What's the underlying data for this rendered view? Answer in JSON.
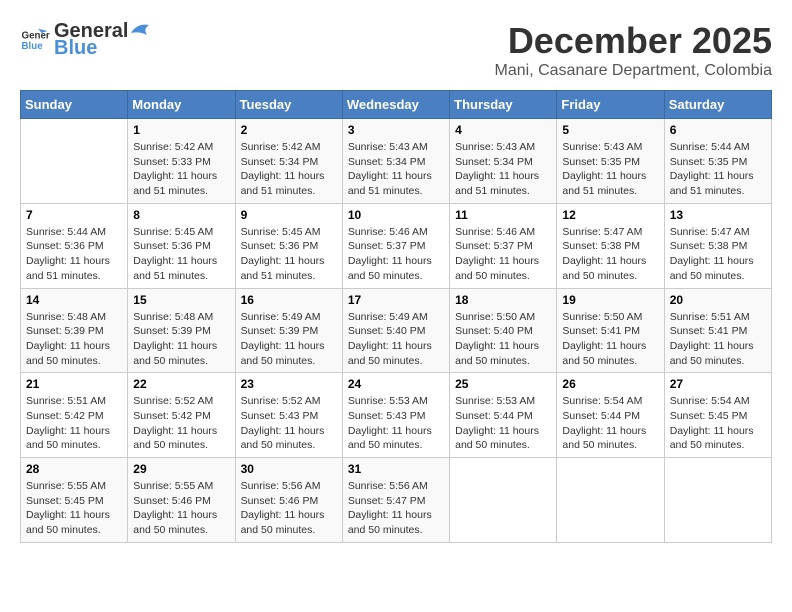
{
  "header": {
    "logo_general": "General",
    "logo_blue": "Blue",
    "title": "December 2025",
    "subtitle": "Mani, Casanare Department, Colombia"
  },
  "days_of_week": [
    "Sunday",
    "Monday",
    "Tuesday",
    "Wednesday",
    "Thursday",
    "Friday",
    "Saturday"
  ],
  "weeks": [
    [
      {
        "day": "",
        "sunrise": "",
        "sunset": "",
        "daylight": ""
      },
      {
        "day": "1",
        "sunrise": "Sunrise: 5:42 AM",
        "sunset": "Sunset: 5:33 PM",
        "daylight": "Daylight: 11 hours and 51 minutes."
      },
      {
        "day": "2",
        "sunrise": "Sunrise: 5:42 AM",
        "sunset": "Sunset: 5:34 PM",
        "daylight": "Daylight: 11 hours and 51 minutes."
      },
      {
        "day": "3",
        "sunrise": "Sunrise: 5:43 AM",
        "sunset": "Sunset: 5:34 PM",
        "daylight": "Daylight: 11 hours and 51 minutes."
      },
      {
        "day": "4",
        "sunrise": "Sunrise: 5:43 AM",
        "sunset": "Sunset: 5:34 PM",
        "daylight": "Daylight: 11 hours and 51 minutes."
      },
      {
        "day": "5",
        "sunrise": "Sunrise: 5:43 AM",
        "sunset": "Sunset: 5:35 PM",
        "daylight": "Daylight: 11 hours and 51 minutes."
      },
      {
        "day": "6",
        "sunrise": "Sunrise: 5:44 AM",
        "sunset": "Sunset: 5:35 PM",
        "daylight": "Daylight: 11 hours and 51 minutes."
      }
    ],
    [
      {
        "day": "7",
        "sunrise": "Sunrise: 5:44 AM",
        "sunset": "Sunset: 5:36 PM",
        "daylight": "Daylight: 11 hours and 51 minutes."
      },
      {
        "day": "8",
        "sunrise": "Sunrise: 5:45 AM",
        "sunset": "Sunset: 5:36 PM",
        "daylight": "Daylight: 11 hours and 51 minutes."
      },
      {
        "day": "9",
        "sunrise": "Sunrise: 5:45 AM",
        "sunset": "Sunset: 5:36 PM",
        "daylight": "Daylight: 11 hours and 51 minutes."
      },
      {
        "day": "10",
        "sunrise": "Sunrise: 5:46 AM",
        "sunset": "Sunset: 5:37 PM",
        "daylight": "Daylight: 11 hours and 50 minutes."
      },
      {
        "day": "11",
        "sunrise": "Sunrise: 5:46 AM",
        "sunset": "Sunset: 5:37 PM",
        "daylight": "Daylight: 11 hours and 50 minutes."
      },
      {
        "day": "12",
        "sunrise": "Sunrise: 5:47 AM",
        "sunset": "Sunset: 5:38 PM",
        "daylight": "Daylight: 11 hours and 50 minutes."
      },
      {
        "day": "13",
        "sunrise": "Sunrise: 5:47 AM",
        "sunset": "Sunset: 5:38 PM",
        "daylight": "Daylight: 11 hours and 50 minutes."
      }
    ],
    [
      {
        "day": "14",
        "sunrise": "Sunrise: 5:48 AM",
        "sunset": "Sunset: 5:39 PM",
        "daylight": "Daylight: 11 hours and 50 minutes."
      },
      {
        "day": "15",
        "sunrise": "Sunrise: 5:48 AM",
        "sunset": "Sunset: 5:39 PM",
        "daylight": "Daylight: 11 hours and 50 minutes."
      },
      {
        "day": "16",
        "sunrise": "Sunrise: 5:49 AM",
        "sunset": "Sunset: 5:39 PM",
        "daylight": "Daylight: 11 hours and 50 minutes."
      },
      {
        "day": "17",
        "sunrise": "Sunrise: 5:49 AM",
        "sunset": "Sunset: 5:40 PM",
        "daylight": "Daylight: 11 hours and 50 minutes."
      },
      {
        "day": "18",
        "sunrise": "Sunrise: 5:50 AM",
        "sunset": "Sunset: 5:40 PM",
        "daylight": "Daylight: 11 hours and 50 minutes."
      },
      {
        "day": "19",
        "sunrise": "Sunrise: 5:50 AM",
        "sunset": "Sunset: 5:41 PM",
        "daylight": "Daylight: 11 hours and 50 minutes."
      },
      {
        "day": "20",
        "sunrise": "Sunrise: 5:51 AM",
        "sunset": "Sunset: 5:41 PM",
        "daylight": "Daylight: 11 hours and 50 minutes."
      }
    ],
    [
      {
        "day": "21",
        "sunrise": "Sunrise: 5:51 AM",
        "sunset": "Sunset: 5:42 PM",
        "daylight": "Daylight: 11 hours and 50 minutes."
      },
      {
        "day": "22",
        "sunrise": "Sunrise: 5:52 AM",
        "sunset": "Sunset: 5:42 PM",
        "daylight": "Daylight: 11 hours and 50 minutes."
      },
      {
        "day": "23",
        "sunrise": "Sunrise: 5:52 AM",
        "sunset": "Sunset: 5:43 PM",
        "daylight": "Daylight: 11 hours and 50 minutes."
      },
      {
        "day": "24",
        "sunrise": "Sunrise: 5:53 AM",
        "sunset": "Sunset: 5:43 PM",
        "daylight": "Daylight: 11 hours and 50 minutes."
      },
      {
        "day": "25",
        "sunrise": "Sunrise: 5:53 AM",
        "sunset": "Sunset: 5:44 PM",
        "daylight": "Daylight: 11 hours and 50 minutes."
      },
      {
        "day": "26",
        "sunrise": "Sunrise: 5:54 AM",
        "sunset": "Sunset: 5:44 PM",
        "daylight": "Daylight: 11 hours and 50 minutes."
      },
      {
        "day": "27",
        "sunrise": "Sunrise: 5:54 AM",
        "sunset": "Sunset: 5:45 PM",
        "daylight": "Daylight: 11 hours and 50 minutes."
      }
    ],
    [
      {
        "day": "28",
        "sunrise": "Sunrise: 5:55 AM",
        "sunset": "Sunset: 5:45 PM",
        "daylight": "Daylight: 11 hours and 50 minutes."
      },
      {
        "day": "29",
        "sunrise": "Sunrise: 5:55 AM",
        "sunset": "Sunset: 5:46 PM",
        "daylight": "Daylight: 11 hours and 50 minutes."
      },
      {
        "day": "30",
        "sunrise": "Sunrise: 5:56 AM",
        "sunset": "Sunset: 5:46 PM",
        "daylight": "Daylight: 11 hours and 50 minutes."
      },
      {
        "day": "31",
        "sunrise": "Sunrise: 5:56 AM",
        "sunset": "Sunset: 5:47 PM",
        "daylight": "Daylight: 11 hours and 50 minutes."
      },
      {
        "day": "",
        "sunrise": "",
        "sunset": "",
        "daylight": ""
      },
      {
        "day": "",
        "sunrise": "",
        "sunset": "",
        "daylight": ""
      },
      {
        "day": "",
        "sunrise": "",
        "sunset": "",
        "daylight": ""
      }
    ]
  ]
}
